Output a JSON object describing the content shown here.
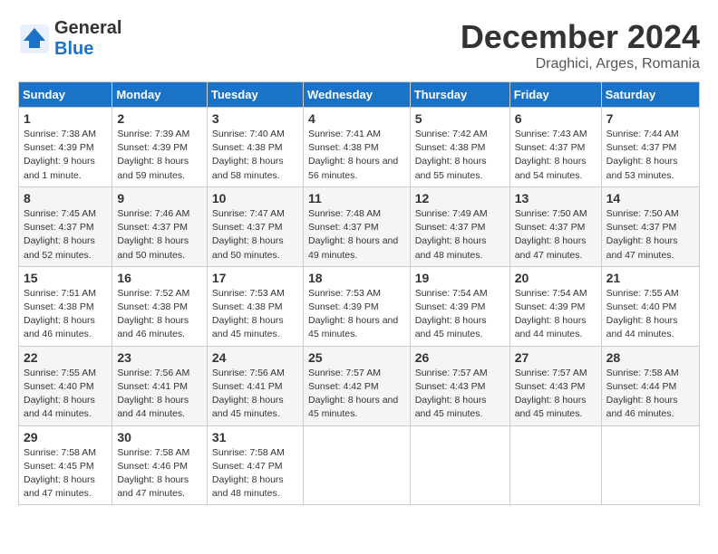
{
  "header": {
    "logo_line1": "General",
    "logo_line2": "Blue",
    "month": "December 2024",
    "location": "Draghici, Arges, Romania"
  },
  "weekdays": [
    "Sunday",
    "Monday",
    "Tuesday",
    "Wednesday",
    "Thursday",
    "Friday",
    "Saturday"
  ],
  "weeks": [
    [
      {
        "day": "1",
        "sunrise": "Sunrise: 7:38 AM",
        "sunset": "Sunset: 4:39 PM",
        "daylight": "Daylight: 9 hours and 1 minute."
      },
      {
        "day": "2",
        "sunrise": "Sunrise: 7:39 AM",
        "sunset": "Sunset: 4:39 PM",
        "daylight": "Daylight: 8 hours and 59 minutes."
      },
      {
        "day": "3",
        "sunrise": "Sunrise: 7:40 AM",
        "sunset": "Sunset: 4:38 PM",
        "daylight": "Daylight: 8 hours and 58 minutes."
      },
      {
        "day": "4",
        "sunrise": "Sunrise: 7:41 AM",
        "sunset": "Sunset: 4:38 PM",
        "daylight": "Daylight: 8 hours and 56 minutes."
      },
      {
        "day": "5",
        "sunrise": "Sunrise: 7:42 AM",
        "sunset": "Sunset: 4:38 PM",
        "daylight": "Daylight: 8 hours and 55 minutes."
      },
      {
        "day": "6",
        "sunrise": "Sunrise: 7:43 AM",
        "sunset": "Sunset: 4:37 PM",
        "daylight": "Daylight: 8 hours and 54 minutes."
      },
      {
        "day": "7",
        "sunrise": "Sunrise: 7:44 AM",
        "sunset": "Sunset: 4:37 PM",
        "daylight": "Daylight: 8 hours and 53 minutes."
      }
    ],
    [
      {
        "day": "8",
        "sunrise": "Sunrise: 7:45 AM",
        "sunset": "Sunset: 4:37 PM",
        "daylight": "Daylight: 8 hours and 52 minutes."
      },
      {
        "day": "9",
        "sunrise": "Sunrise: 7:46 AM",
        "sunset": "Sunset: 4:37 PM",
        "daylight": "Daylight: 8 hours and 50 minutes."
      },
      {
        "day": "10",
        "sunrise": "Sunrise: 7:47 AM",
        "sunset": "Sunset: 4:37 PM",
        "daylight": "Daylight: 8 hours and 50 minutes."
      },
      {
        "day": "11",
        "sunrise": "Sunrise: 7:48 AM",
        "sunset": "Sunset: 4:37 PM",
        "daylight": "Daylight: 8 hours and 49 minutes."
      },
      {
        "day": "12",
        "sunrise": "Sunrise: 7:49 AM",
        "sunset": "Sunset: 4:37 PM",
        "daylight": "Daylight: 8 hours and 48 minutes."
      },
      {
        "day": "13",
        "sunrise": "Sunrise: 7:50 AM",
        "sunset": "Sunset: 4:37 PM",
        "daylight": "Daylight: 8 hours and 47 minutes."
      },
      {
        "day": "14",
        "sunrise": "Sunrise: 7:50 AM",
        "sunset": "Sunset: 4:37 PM",
        "daylight": "Daylight: 8 hours and 47 minutes."
      }
    ],
    [
      {
        "day": "15",
        "sunrise": "Sunrise: 7:51 AM",
        "sunset": "Sunset: 4:38 PM",
        "daylight": "Daylight: 8 hours and 46 minutes."
      },
      {
        "day": "16",
        "sunrise": "Sunrise: 7:52 AM",
        "sunset": "Sunset: 4:38 PM",
        "daylight": "Daylight: 8 hours and 46 minutes."
      },
      {
        "day": "17",
        "sunrise": "Sunrise: 7:53 AM",
        "sunset": "Sunset: 4:38 PM",
        "daylight": "Daylight: 8 hours and 45 minutes."
      },
      {
        "day": "18",
        "sunrise": "Sunrise: 7:53 AM",
        "sunset": "Sunset: 4:39 PM",
        "daylight": "Daylight: 8 hours and 45 minutes."
      },
      {
        "day": "19",
        "sunrise": "Sunrise: 7:54 AM",
        "sunset": "Sunset: 4:39 PM",
        "daylight": "Daylight: 8 hours and 45 minutes."
      },
      {
        "day": "20",
        "sunrise": "Sunrise: 7:54 AM",
        "sunset": "Sunset: 4:39 PM",
        "daylight": "Daylight: 8 hours and 44 minutes."
      },
      {
        "day": "21",
        "sunrise": "Sunrise: 7:55 AM",
        "sunset": "Sunset: 4:40 PM",
        "daylight": "Daylight: 8 hours and 44 minutes."
      }
    ],
    [
      {
        "day": "22",
        "sunrise": "Sunrise: 7:55 AM",
        "sunset": "Sunset: 4:40 PM",
        "daylight": "Daylight: 8 hours and 44 minutes."
      },
      {
        "day": "23",
        "sunrise": "Sunrise: 7:56 AM",
        "sunset": "Sunset: 4:41 PM",
        "daylight": "Daylight: 8 hours and 44 minutes."
      },
      {
        "day": "24",
        "sunrise": "Sunrise: 7:56 AM",
        "sunset": "Sunset: 4:41 PM",
        "daylight": "Daylight: 8 hours and 45 minutes."
      },
      {
        "day": "25",
        "sunrise": "Sunrise: 7:57 AM",
        "sunset": "Sunset: 4:42 PM",
        "daylight": "Daylight: 8 hours and 45 minutes."
      },
      {
        "day": "26",
        "sunrise": "Sunrise: 7:57 AM",
        "sunset": "Sunset: 4:43 PM",
        "daylight": "Daylight: 8 hours and 45 minutes."
      },
      {
        "day": "27",
        "sunrise": "Sunrise: 7:57 AM",
        "sunset": "Sunset: 4:43 PM",
        "daylight": "Daylight: 8 hours and 45 minutes."
      },
      {
        "day": "28",
        "sunrise": "Sunrise: 7:58 AM",
        "sunset": "Sunset: 4:44 PM",
        "daylight": "Daylight: 8 hours and 46 minutes."
      }
    ],
    [
      {
        "day": "29",
        "sunrise": "Sunrise: 7:58 AM",
        "sunset": "Sunset: 4:45 PM",
        "daylight": "Daylight: 8 hours and 47 minutes."
      },
      {
        "day": "30",
        "sunrise": "Sunrise: 7:58 AM",
        "sunset": "Sunset: 4:46 PM",
        "daylight": "Daylight: 8 hours and 47 minutes."
      },
      {
        "day": "31",
        "sunrise": "Sunrise: 7:58 AM",
        "sunset": "Sunset: 4:47 PM",
        "daylight": "Daylight: 8 hours and 48 minutes."
      },
      null,
      null,
      null,
      null
    ]
  ]
}
